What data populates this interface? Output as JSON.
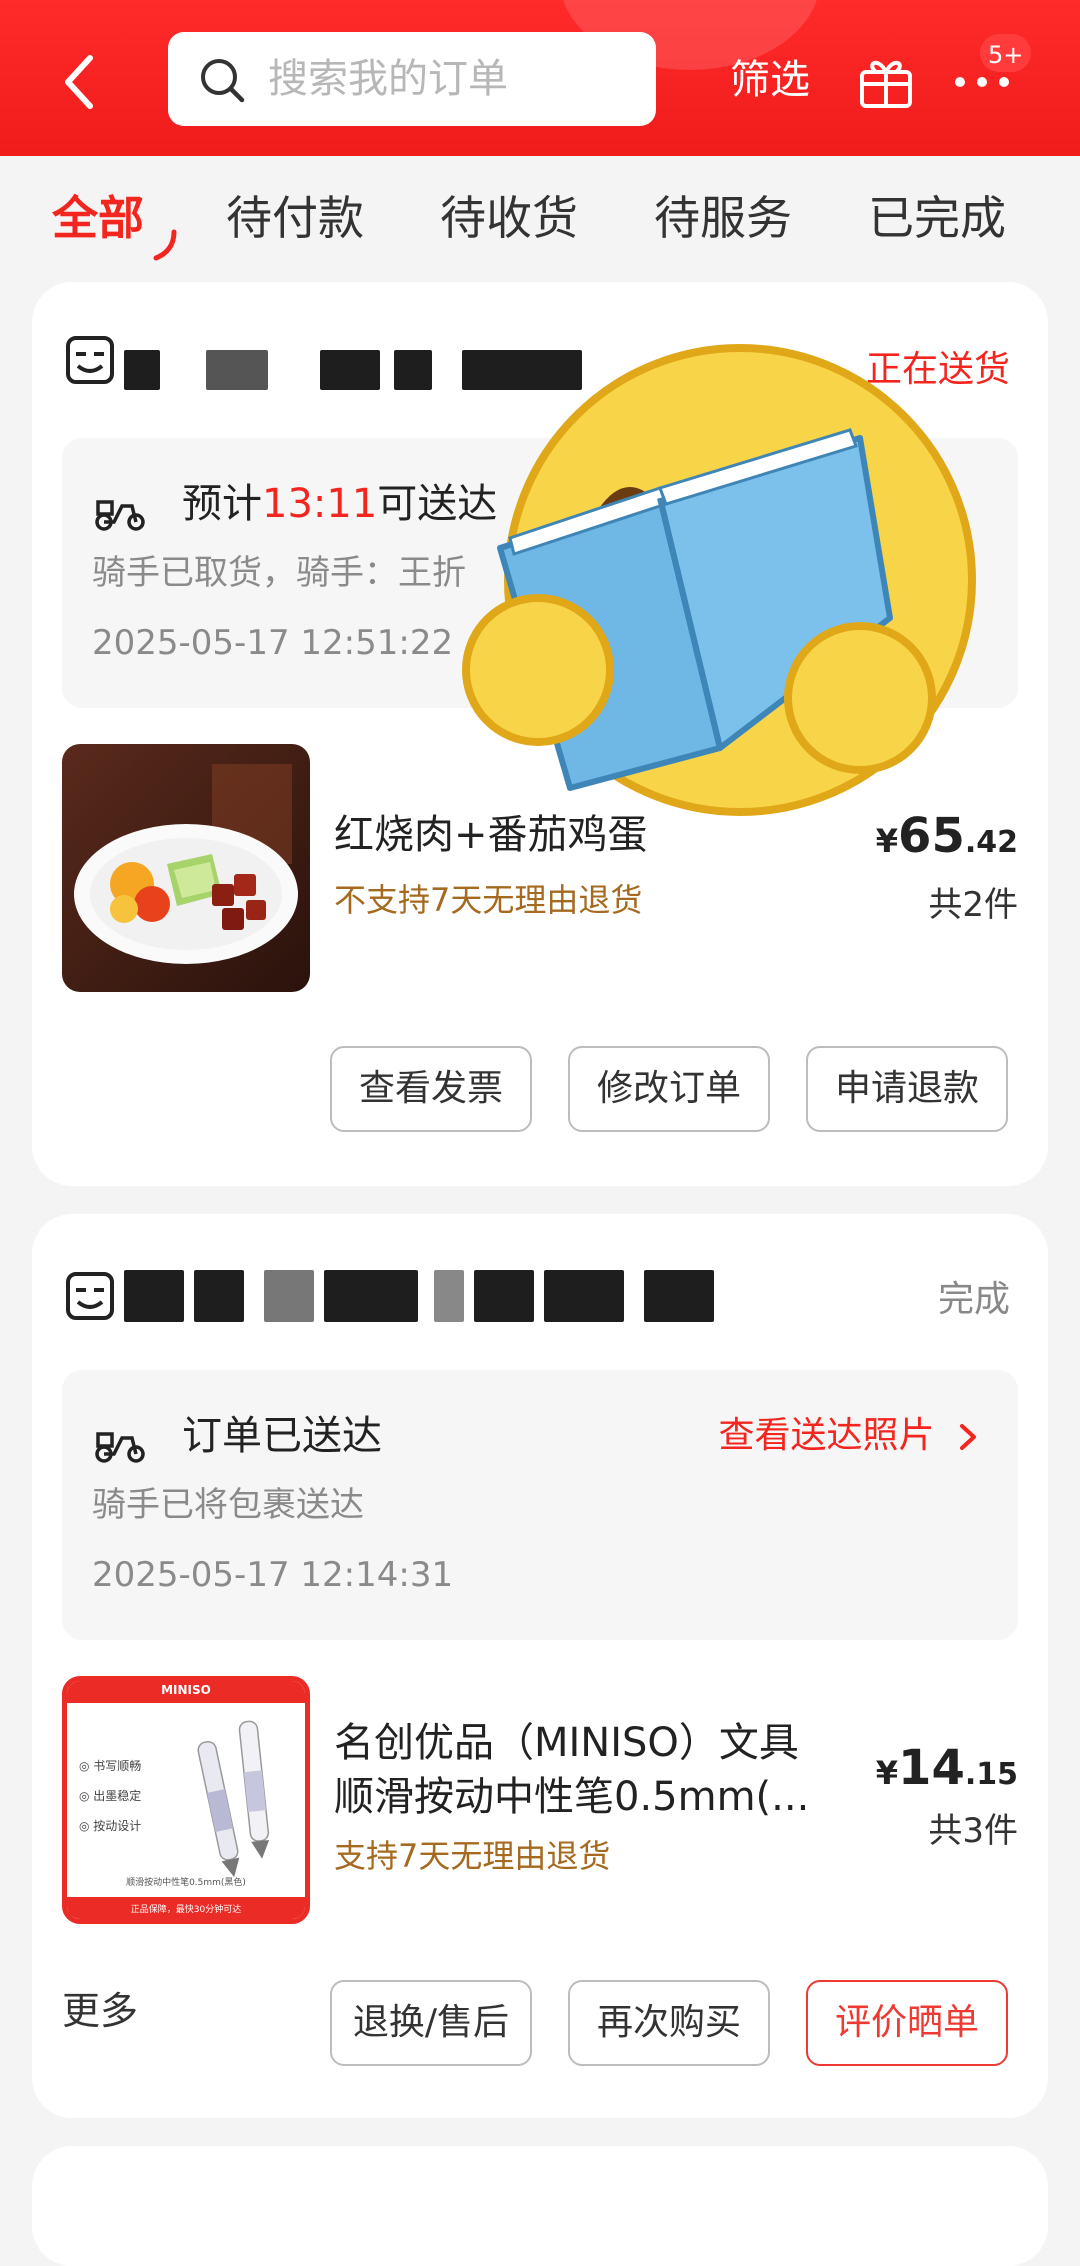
{
  "header": {
    "search_placeholder": "搜索我的订单",
    "filter_label": "筛选",
    "badge": "5+"
  },
  "tabs": [
    {
      "label": "全部",
      "active": true
    },
    {
      "label": "待付款",
      "active": false
    },
    {
      "label": "待收货",
      "active": false
    },
    {
      "label": "待服务",
      "active": false
    },
    {
      "label": "已完成",
      "active": false
    }
  ],
  "orders": [
    {
      "status": "正在送货",
      "delivery": {
        "title_prefix": "预计",
        "title_time": "13:11",
        "title_suffix": "可送达",
        "sub": "骑手已取货，骑手：王折",
        "timestamp": "2025-05-17 12:51:22"
      },
      "product": {
        "name": "红烧肉+番茄鸡蛋",
        "tag": "不支持7天无理由退货",
        "price_yen": "¥",
        "price_int": "65",
        "price_dec": ".42",
        "count": "共2件"
      },
      "buttons": [
        "查看发票",
        "修改订单",
        "申请退款"
      ]
    },
    {
      "status": "完成",
      "delivery": {
        "title": "订单已送达",
        "link": "查看送达照片",
        "sub": "骑手已将包裹送达",
        "timestamp": "2025-05-17 12:14:31"
      },
      "product": {
        "name_line1": "名创优品（MINISO）文具",
        "name_line2": "顺滑按动中性笔0.5mm(...",
        "tag": "支持7天无理由退货",
        "price_yen": "¥",
        "price_int": "14",
        "price_dec": ".15",
        "count": "共3件",
        "thumb_brand": "MINISO",
        "thumb_features": [
          "书写顺畅",
          "出墨稳定",
          "按动设计"
        ],
        "thumb_caption": "顺滑按动中性笔0.5mm(黑色)",
        "thumb_footer": "正品保障，最快30分钟可达"
      },
      "more_label": "更多",
      "buttons": [
        "退换/售后",
        "再次购买",
        "评价晒单"
      ]
    }
  ],
  "colors": {
    "brand_red": "#f2251f",
    "tag_brown": "#a56a1f",
    "header_red": "#f01b1b"
  }
}
